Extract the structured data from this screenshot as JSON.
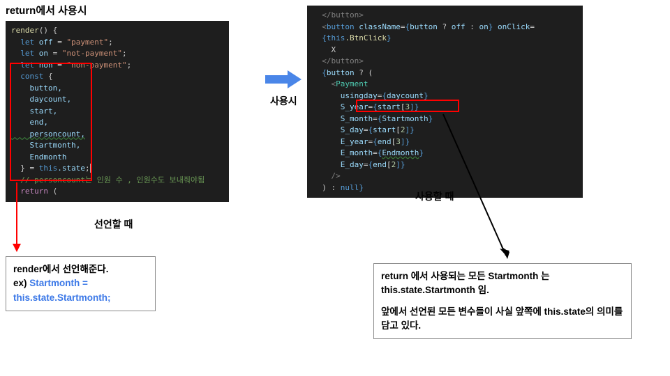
{
  "title": "return에서 사용시",
  "labels": {
    "use_arrow": "사용시",
    "declare": "선언할 때",
    "use_when": "사용할 때"
  },
  "note_left": {
    "heading": "render에서 선언해준다.",
    "ex_prefix": "ex) ",
    "example": "Startmonth = this.state.Startmonth;"
  },
  "note_right": {
    "line1": "return 에서 사용되는 모든 Startmonth 는 this.state.Startmonth 임.",
    "line2": "앞에서 선언된 모든 변수들이 사실 앞쪽에 this.state의 의미를 담고 있다."
  },
  "code_left": {
    "l1_fn": "render",
    "l1_p": "() {",
    "l2_kw": "let",
    "l2_var": " off",
    "l2_eq": " = ",
    "l2_str": "\"payment\"",
    "l2_sc": ";",
    "l3_kw": "let",
    "l3_var": " on",
    "l3_eq": " = ",
    "l3_str": "\"not-payment\"",
    "l3_sc": ";",
    "l4_kw": "let",
    "l4_var": " non",
    "l4_eq": " = ",
    "l4_str": "\"non-payment\"",
    "l4_sc": ";",
    "l5_kw": "const",
    "l5_b": " {",
    "l6": "    button,",
    "l7": "    daycount,",
    "l8": "    start,",
    "l9": "    end,",
    "l10": "    personcount,",
    "l11": "    Startmonth,",
    "l12": "    Endmonth",
    "l13_b": "  } = ",
    "l13_this": "this",
    "l13_state": ".state",
    "l13_sc": ";",
    "l14": "  // personcount는 인원 수 , 인원수도 보내줘야됨",
    "l15_kw": "return",
    "l15_p": " ("
  },
  "code_right": {
    "l1": "  </button>",
    "l2a": "  <",
    "l2b": "button",
    "l2c": " className",
    "l2d": "=",
    "l2e": "{",
    "l2f": "button",
    "l2g": " ? ",
    "l2h": "off",
    "l2i": " : ",
    "l2j": "on",
    "l2k": "}",
    "l2l": " onClick",
    "l2m": "=",
    "l3a": "  {",
    "l3b": "this",
    "l3c": ".BtnClick",
    "l3d": "}",
    "l4": "    X",
    "l5": "  </button>",
    "l6a": "  {",
    "l6b": "button",
    "l6c": " ? (",
    "l7a": "    <",
    "l7b": "Payment",
    "l8a": "      usingday",
    "l8b": "=",
    "l8c": "{",
    "l8d": "daycount",
    "l8e": "}",
    "l9a": "      S_year",
    "l9b": "=",
    "l9c": "{",
    "l9d": "start",
    "l9e": "[",
    "l9f": "3",
    "l9g": "]}",
    "l10a": "      S_month",
    "l10b": "=",
    "l10c": "{",
    "l10d": "Startmonth",
    "l10e": "}",
    "l11a": "      S_day",
    "l11b": "=",
    "l11c": "{",
    "l11d": "start",
    "l11e": "[",
    "l11f": "2",
    "l11g": "]}",
    "l12a": "      E_year",
    "l12b": "=",
    "l12c": "{",
    "l12d": "end",
    "l12e": "[",
    "l12f": "3",
    "l12g": "]}",
    "l13a": "      E_month",
    "l13b": "=",
    "l13c": "{",
    "l13d": "Endmonth",
    "l13e": "}",
    "l14a": "      E_day",
    "l14b": "=",
    "l14c": "{",
    "l14d": "end",
    "l14e": "[",
    "l14f": "2",
    "l14g": "]}",
    "l15": "    />",
    "l16a": "  ) : ",
    "l16b": "null",
    "l16c": "}"
  }
}
